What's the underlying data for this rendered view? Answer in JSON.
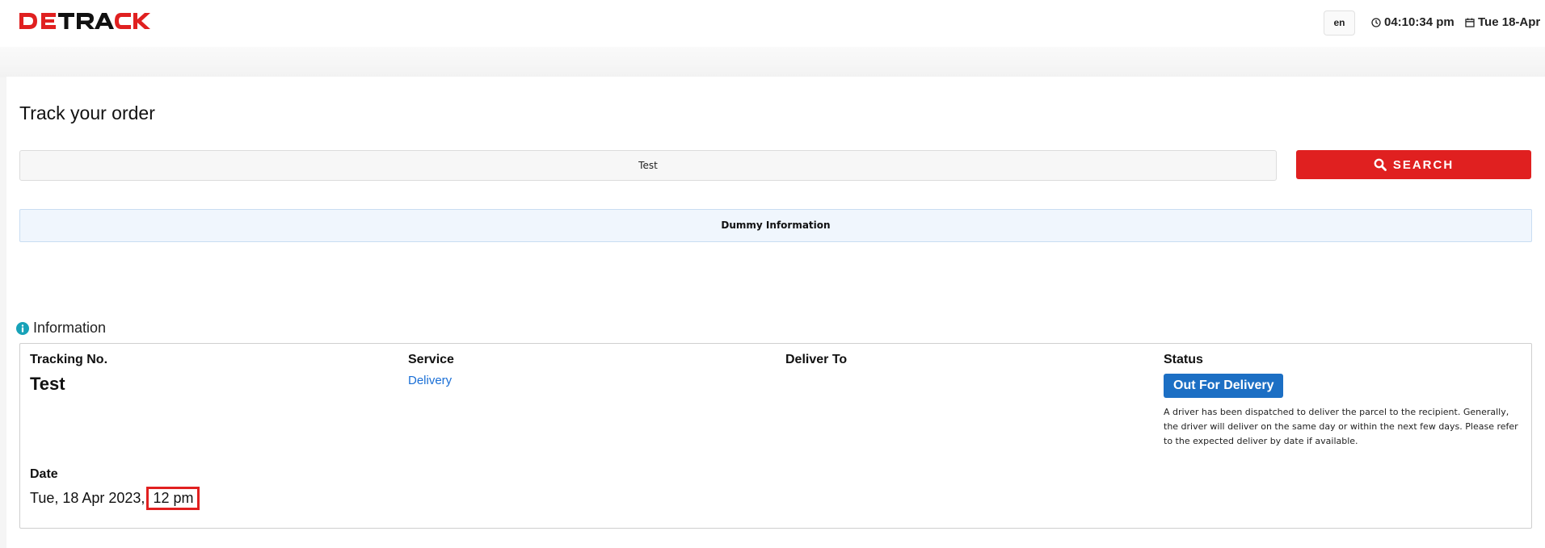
{
  "header": {
    "logo_text": "DETRACK",
    "language": "en",
    "time": "04:10:34 pm",
    "date": "Tue 18-Apr"
  },
  "page": {
    "title": "Track your order"
  },
  "search": {
    "value": "Test",
    "button_label": "SEARCH"
  },
  "notice": {
    "text": "Dummy Information"
  },
  "information": {
    "heading": "Information",
    "tracking_label": "Tracking No.",
    "tracking_value": "Test",
    "service_label": "Service",
    "service_value": "Delivery",
    "deliver_to_label": "Deliver To",
    "status_label": "Status",
    "status_value": "Out For Delivery",
    "status_description": "A driver has been dispatched to deliver the parcel to the recipient. Generally, the driver will deliver on the same day or within the next few days. Please refer to the expected deliver by date if available.",
    "date_label": "Date",
    "date_value": "Tue, 18 Apr 2023,",
    "time_value": "12 pm"
  },
  "colors": {
    "brand_red": "#e02020",
    "status_blue": "#1c6fc4",
    "link_blue": "#1a6fd6",
    "info_icon_teal": "#17a2b8"
  }
}
